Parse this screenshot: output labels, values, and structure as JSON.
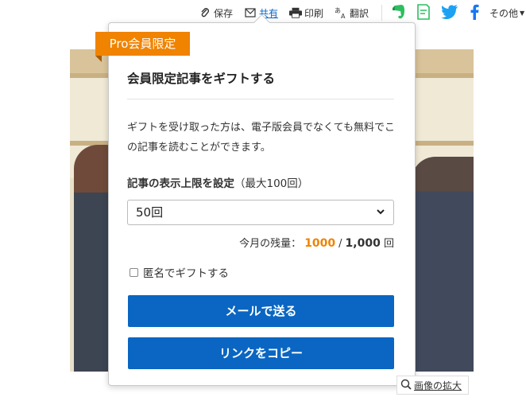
{
  "toolbar": {
    "save_label": "保存",
    "share_label": "共有",
    "print_label": "印刷",
    "translate_label": "翻訳",
    "other_label": "その他"
  },
  "colors": {
    "accent_blue": "#0a66c2",
    "pro_orange": "#f08300",
    "evernote_green": "#2dbe60",
    "twitter_blue": "#1da1f2",
    "facebook_blue": "#1877f2"
  },
  "popup": {
    "badge": "Pro会員限定",
    "title": "会員限定記事をギフトする",
    "description": "ギフトを受け取った方は、電子版会員でなくても無料でこの記事を読むことができます。",
    "limit_label_bold": "記事の表示上限を設定",
    "limit_label_note": "（最大100回）",
    "select_value": "50回",
    "remaining_label": "今月の残量：",
    "remaining_current": "1000",
    "remaining_total": "1,000",
    "remaining_unit": "回",
    "anonymous_label": "匿名でギフトする",
    "mail_button": "メールで送る",
    "copy_button": "リンクをコピー"
  },
  "image_zoom_label": "画像の拡大"
}
